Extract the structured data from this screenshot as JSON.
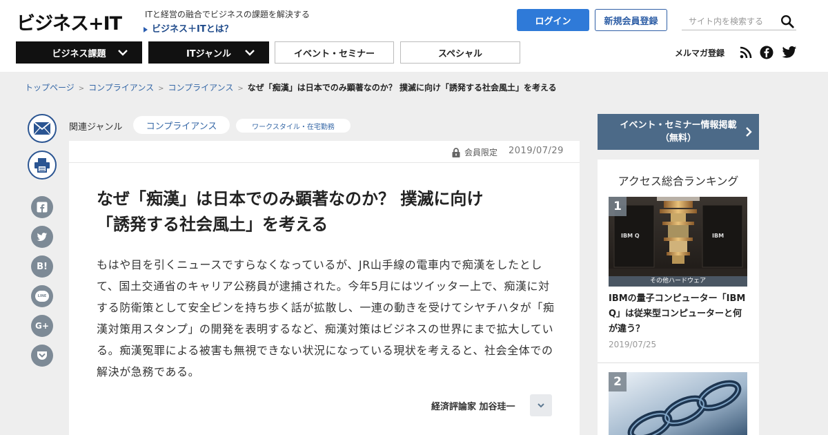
{
  "header": {
    "logo": "ビジネス+IT",
    "tagline": "ITと経営の融合でビジネスの課題を解決する",
    "about_link": "ビジネス＋ITとは？",
    "login": "ログイン",
    "register": "新規会員登録",
    "search_placeholder": "サイト内を検索する",
    "mailmag": "メルマガ登録"
  },
  "nav": {
    "items": [
      {
        "label": "ビジネス課題"
      },
      {
        "label": "ITジャンル"
      },
      {
        "label": "イベント・セミナー"
      },
      {
        "label": "スペシャル"
      }
    ]
  },
  "breadcrumb": {
    "items": [
      "トップページ",
      "コンプライアンス",
      "コンプライアンス"
    ],
    "current": "なぜ「痴漢」は日本でのみ顕著なのか？ 撲滅に向け「誘発する社会風土」を考える",
    "separator": ">"
  },
  "share": {
    "hatena": "B!",
    "line": "LINE",
    "google": "G+"
  },
  "genre": {
    "label": "関連ジャンル",
    "tags": [
      "コンプライアンス",
      "ワークスタイル・在宅勤務"
    ]
  },
  "article": {
    "members_only": "会員限定",
    "date": "2019/07/29",
    "title_line1": "なぜ「痴漢」は日本でのみ顕著なのか？ 撲滅に向け",
    "title_line2": "「誘発する社会風土」を考える",
    "lead": "もはや目を引くニュースですらなくなっているが、JR山手線の電車内で痴漢をしたとして、国土交通省のキャリア公務員が逮捕された。今年5月にはツイッター上で、痴漢に対する防衛策として安全ピンを持ち歩く話が拡散し、一連の動きを受けてシヤチハタが「痴漢対策用スタンプ」の開発を表明するなど、痴漢対策はビジネスの世界にまで拡大している。痴漢冤罪による被害も無視できない状況になっている現状を考えると、社会全体での解決が急務である。",
    "author": "経済評論家 加谷珪一"
  },
  "sidebar": {
    "event_banner_line1": "イベント・セミナー情報掲載",
    "event_banner_line2": "（無料）",
    "ranking_title": "アクセス総合ランキング",
    "ranking": [
      {
        "rank": "1",
        "category": "その他ハードウェア",
        "title": "IBMの量子コンピューター「IBM Q」は従来型コンピューターと何が違う？",
        "date": "2019/07/25",
        "img_text_left": "IBM Q",
        "img_text_right": "IBM"
      },
      {
        "rank": "2"
      }
    ]
  },
  "colors": {
    "login_blue": "#2f7ad8",
    "link_blue": "#3567a6",
    "banner": "#4c6a88",
    "share_gray": "#7d8a96"
  }
}
